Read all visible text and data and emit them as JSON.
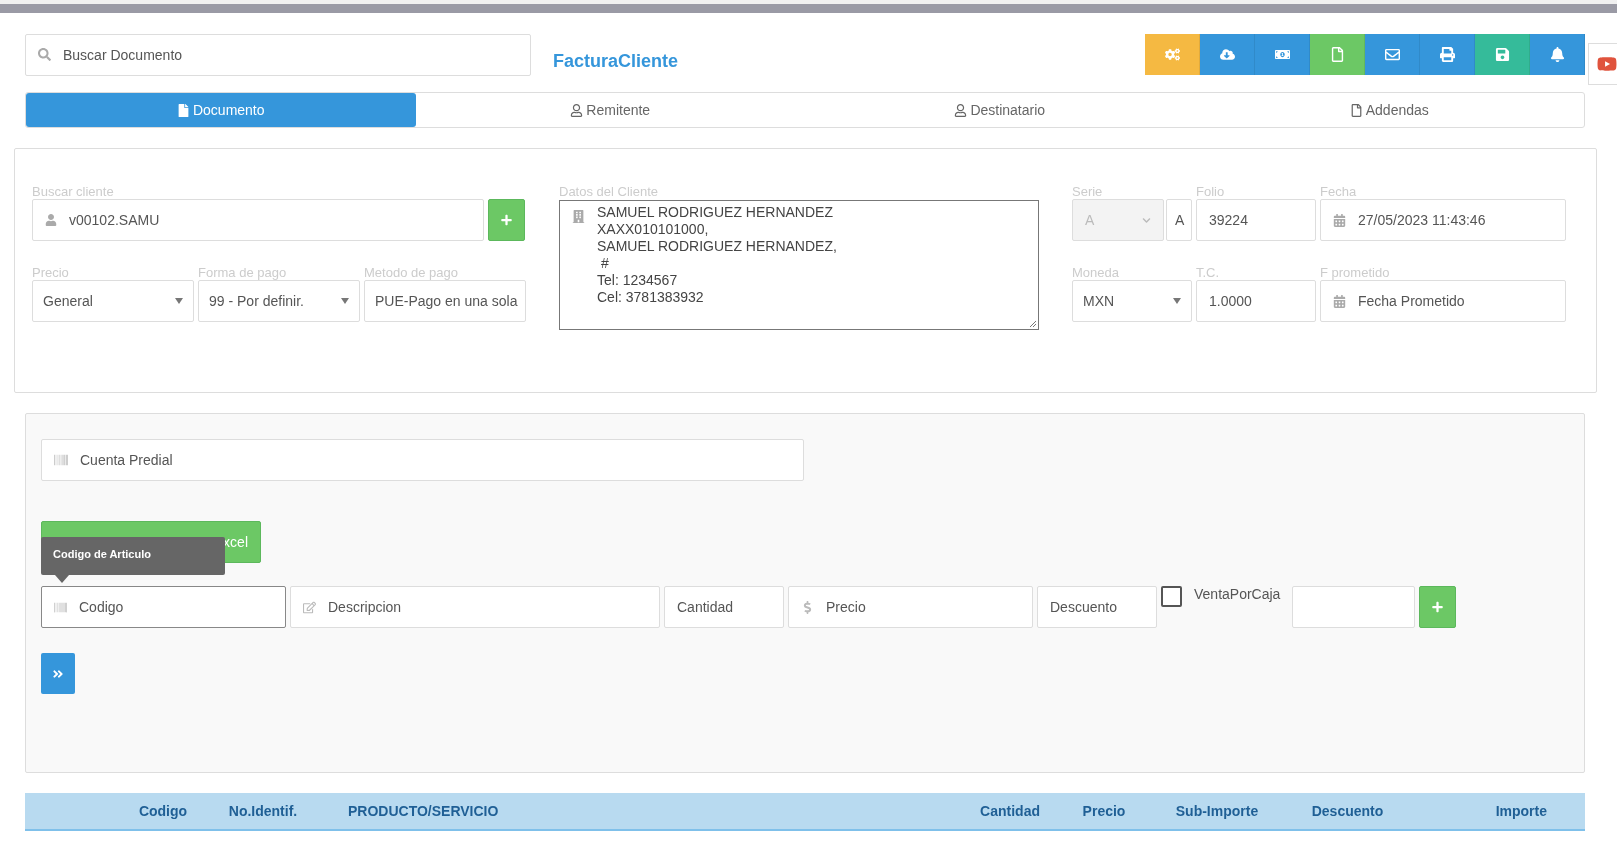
{
  "search": {
    "placeholder": "Buscar Documento"
  },
  "title": "FacturaCliente",
  "toolbar": [
    {
      "kind": "gears",
      "color": "#f5b942"
    },
    {
      "kind": "cloud",
      "color": "#3596db"
    },
    {
      "kind": "money",
      "color": "#3596db"
    },
    {
      "kind": "file",
      "color": "#6cc865"
    },
    {
      "kind": "mail",
      "color": "#3596db"
    },
    {
      "kind": "print",
      "color": "#3596db"
    },
    {
      "kind": "save",
      "color": "#35bb9a"
    },
    {
      "kind": "bell",
      "color": "#3596db"
    }
  ],
  "tabs": [
    {
      "label": "Documento",
      "kind": "file",
      "selected": true
    },
    {
      "label": "Remitente",
      "kind": "user",
      "selected": false
    },
    {
      "label": "Destinatario",
      "kind": "user",
      "selected": false
    },
    {
      "label": "Addendas",
      "kind": "file",
      "selected": false
    }
  ],
  "client": {
    "label": "Buscar cliente",
    "value": "v00102.SAMU"
  },
  "selects": [
    {
      "label": "Precio",
      "value": "General",
      "kind": "select"
    },
    {
      "label": "Forma de pago",
      "value": "99 - Por definir.",
      "kind": "select"
    },
    {
      "label": "Metodo de pago",
      "value": "PUE-Pago en una sola",
      "kind": "input"
    }
  ],
  "client_data": {
    "label": "Datos del Cliente",
    "lines": [
      "SAMUEL RODRIGUEZ HERNANDEZ",
      "XAXX010101000,",
      "SAMUEL RODRIGUEZ HERNANDEZ,",
      " #",
      "Tel: 1234567",
      "Cel: 3781383932"
    ]
  },
  "serie": {
    "label": "Serie",
    "value": "A",
    "extra": "A",
    "disabled": true
  },
  "folio": {
    "label": "Folio",
    "value": "39224"
  },
  "fecha": {
    "label": "Fecha",
    "value": "27/05/2023 11:43:46"
  },
  "moneda": {
    "label": "Moneda",
    "value": "MXN"
  },
  "tc": {
    "label": "T.C.",
    "value": "1.0000"
  },
  "prometido": {
    "label": "F prometido",
    "placeholder": "Fecha Prometido"
  },
  "predial": {
    "placeholder": "Cuenta Predial"
  },
  "excel_button": {
    "label": "xcel"
  },
  "tooltip": "Codigo de Articulo",
  "item_fields": [
    {
      "placeholder": "Codigo",
      "kind": "barcode"
    },
    {
      "placeholder": "Descripcion",
      "kind": "edit"
    },
    {
      "placeholder": "Cantidad",
      "kind": "plain"
    },
    {
      "placeholder": "Precio",
      "kind": "dollar"
    },
    {
      "placeholder": "Descuento",
      "kind": "plain"
    }
  ],
  "venta_por_caja": {
    "label": "VentaPorCaja",
    "checked": false
  },
  "table": {
    "columns": [
      "Codigo",
      "No.Identif.",
      "PRODUCTO/SERVICIO",
      "Cantidad",
      "Precio",
      "Sub-Importe",
      "Descuento",
      "Importe"
    ]
  }
}
